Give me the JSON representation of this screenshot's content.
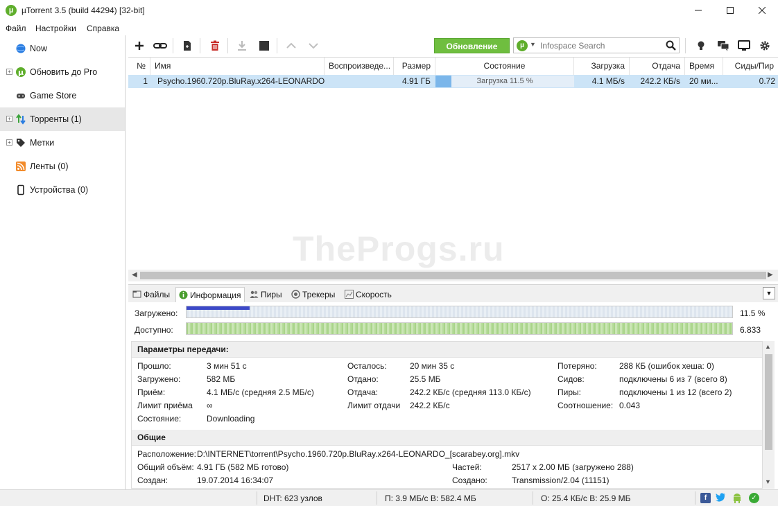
{
  "window": {
    "title": "µTorrent 3.5  (build 44294) [32-bit]"
  },
  "menu": [
    "Файл",
    "Настройки",
    "Справка"
  ],
  "sidebar": {
    "items": [
      {
        "label": "Now",
        "icon": "globe-icon",
        "expandable": false
      },
      {
        "label": "Обновить до Pro",
        "icon": "utorrent-icon",
        "expandable": true
      },
      {
        "label": "Game Store",
        "icon": "gamepad-icon",
        "expandable": false
      },
      {
        "label": "Торренты (1)",
        "icon": "transfer-arrows-icon",
        "expandable": true,
        "selected": true
      },
      {
        "label": "Метки",
        "icon": "tag-icon",
        "expandable": true
      },
      {
        "label": "Ленты (0)",
        "icon": "rss-icon",
        "expandable": false
      },
      {
        "label": "Устройства (0)",
        "icon": "device-icon",
        "expandable": false
      }
    ]
  },
  "toolbar": {
    "update_label": "Обновление",
    "search_placeholder": "Infospace Search"
  },
  "list": {
    "columns": [
      "№",
      "Имя",
      "Воспроизведе...",
      "Размер",
      "Состояние",
      "Загрузка",
      "Отдача",
      "Время",
      "Сиды/Пир"
    ],
    "rows": [
      {
        "num": "1",
        "name": "Psycho.1960.720p.BluRay.x264-LEONARDO_...",
        "play": "",
        "size": "4.91 ГБ",
        "progress": 0.115,
        "status": "Загрузка 11.5 %",
        "down": "4.1 МБ/s",
        "up": "242.2 КБ/s",
        "time": "20 ми...",
        "ratio": "0.72"
      }
    ]
  },
  "tabs": [
    {
      "label": "Файлы",
      "icon": "files-icon",
      "active": false
    },
    {
      "label": "Информация",
      "icon": "info-icon",
      "active": true
    },
    {
      "label": "Пиры",
      "icon": "peers-icon",
      "active": false
    },
    {
      "label": "Трекеры",
      "icon": "trackers-icon",
      "active": false
    },
    {
      "label": "Скорость",
      "icon": "speed-chart-icon",
      "active": false
    }
  ],
  "bars": {
    "downloaded_label": "Загружено:",
    "downloaded_value": "11.5 %",
    "downloaded_fraction": 0.115,
    "available_label": "Доступно:",
    "available_value": "6.833"
  },
  "info": {
    "transfer_title": "Параметры передачи:",
    "transfer": [
      [
        {
          "k": "Прошло:",
          "v": "3 мин 51 с"
        },
        {
          "k": "Осталось:",
          "v": "20 мин 35 с"
        },
        {
          "k": "Потеряно:",
          "v": "288 КБ (ошибок хеша: 0)"
        }
      ],
      [
        {
          "k": "Загружено:",
          "v": "582 МБ"
        },
        {
          "k": "Отдано:",
          "v": "25.5 МБ"
        },
        {
          "k": "Сидов:",
          "v": "подключены 6 из 7 (всего 8)"
        }
      ],
      [
        {
          "k": "Приём:",
          "v": "4.1 МБ/с (средняя 2.5 МБ/с)"
        },
        {
          "k": "Отдача:",
          "v": "242.2 КБ/с (средняя 113.0 КБ/с)"
        },
        {
          "k": "Пиры:",
          "v": "подключены 1 из 12 (всего 2)"
        }
      ],
      [
        {
          "k": "Лимит приёма",
          "v": "∞"
        },
        {
          "k": "Лимит отдачи",
          "v": "242.2 КБ/с"
        },
        {
          "k": "Соотношение:",
          "v": "0.043"
        }
      ],
      [
        {
          "k": "Состояние:",
          "v": "Downloading"
        }
      ]
    ],
    "general_title": "Общие",
    "location_label": "Расположение:",
    "location": "D:\\INTERNET\\torrent\\Psycho.1960.720p.BluRay.x264-LEONARDO_[scarabey.org].mkv",
    "total_label": "Общий объём:",
    "total": "4.91 ГБ (582 МБ готово)",
    "pieces_label": "Частей:",
    "pieces": "2517 x 2.00 МБ (загружено 288)",
    "created_label": "Создан:",
    "created": "19.07.2014 16:34:07",
    "created_by_label": "Создано:",
    "created_by": "Transmission/2.04 (11151)"
  },
  "status": {
    "dht": "DHT: 623 узлов",
    "download": "П: 3.9 МБ/с В: 582.4 МБ",
    "upload": "О: 25.4 КБ/с В: 25.9 МБ"
  },
  "watermark": "TheProgs.ru",
  "colors": {
    "accent_green": "#6fbe3f",
    "selection": "#cce4f7",
    "progress_blue": "#3c49c8"
  }
}
